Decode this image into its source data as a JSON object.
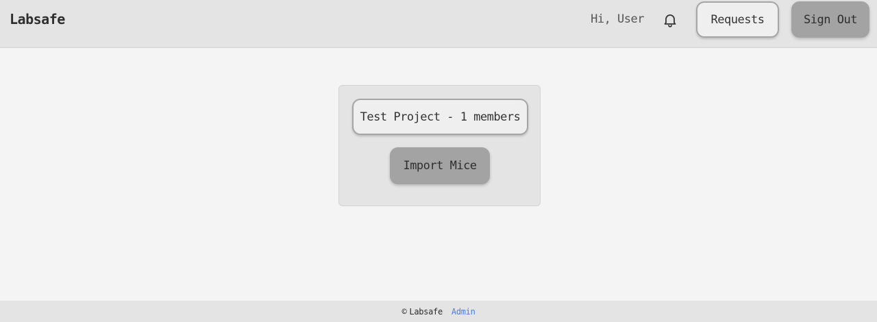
{
  "header": {
    "brand": "Labsafe",
    "greeting": "Hi, User",
    "notification_icon": "bell-icon",
    "requests_label": "Requests",
    "sign_out_label": "Sign Out"
  },
  "main": {
    "project_label": "Test Project - 1 members",
    "import_label": "Import Mice"
  },
  "footer": {
    "copyright_symbol": "©",
    "brand": "Labsafe",
    "admin_link": "Admin"
  },
  "colors": {
    "background": "#f4f4f4",
    "header_bg": "#e4e4e4",
    "primary_button": "#a3a3a3",
    "outline_button_border": "#a5a5a5",
    "link": "#4a7fd9"
  }
}
